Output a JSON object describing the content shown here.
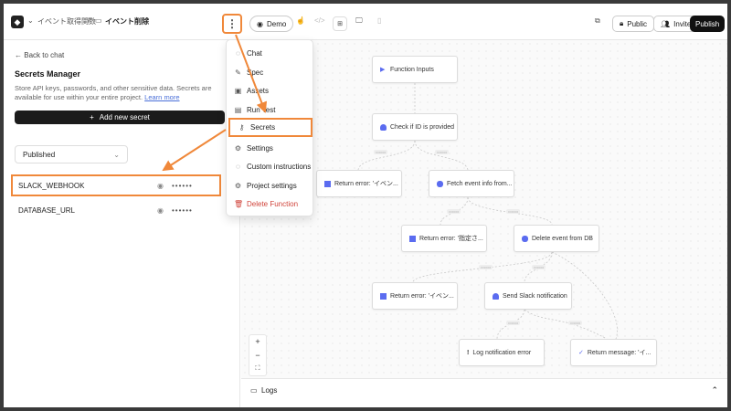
{
  "header": {
    "breadcrumb_parent": "イベント取得関数",
    "separator": "/",
    "breadcrumb_current": "イベント削除",
    "demo_label": "Demo",
    "public_label": "Public",
    "invite_label": "Invite",
    "publish_label": "Publish"
  },
  "sidebar": {
    "back_label": "Back to chat",
    "title": "Secrets Manager",
    "desc_line1": "Store API keys, passwords, and other sensitive data. Secrets are",
    "desc_line2": "available for use within your entire project.",
    "learn_more": "Learn more",
    "add_secret": "Add new secret",
    "filter_value": "Published",
    "secrets": [
      {
        "name": "SLACK_WEBHOOK",
        "mask": "••••••"
      },
      {
        "name": "DATABASE_URL",
        "mask": "••••••"
      }
    ]
  },
  "menu": {
    "items": [
      {
        "label": "Chat",
        "icon": "chat-icon"
      },
      {
        "label": "Spec",
        "icon": "spec-icon"
      },
      {
        "label": "Assets",
        "icon": "image-icon"
      },
      {
        "label": "Run Test",
        "icon": "terminal-icon"
      },
      {
        "label": "Secrets",
        "icon": "key-icon"
      },
      {
        "label": "Settings",
        "icon": "gear-icon"
      },
      {
        "label": "Custom instructions",
        "icon": "message-icon"
      },
      {
        "label": "Project settings",
        "icon": "gear-icon"
      },
      {
        "label": "Delete Function",
        "icon": "trash-icon"
      }
    ],
    "danger_color": "#d0433a"
  },
  "flow": {
    "nodes": [
      {
        "label": "Function Inputs",
        "icon": "play-icon"
      },
      {
        "label": "Check if ID is provided",
        "icon": "user-icon"
      },
      {
        "label": "Return error: 'イベン...",
        "icon": "stop-icon"
      },
      {
        "label": "Fetch event info from...",
        "icon": "database-icon"
      },
      {
        "label": "Return error: '指定さ...",
        "icon": "stop-icon"
      },
      {
        "label": "Delete event from DB",
        "icon": "database-icon"
      },
      {
        "label": "Return error: 'イベン...",
        "icon": "stop-icon"
      },
      {
        "label": "Send Slack notification",
        "icon": "bell-icon"
      },
      {
        "label": "Log notification error",
        "icon": "alert-icon"
      },
      {
        "label": "Return message: 'イ...",
        "icon": "check-icon"
      }
    ],
    "accent": "#5b6cf0"
  },
  "logs": {
    "label": "Logs"
  },
  "zoom": {
    "in": "+",
    "out": "−",
    "fit": "⛶"
  },
  "colors": {
    "highlight": "#f0883a"
  }
}
